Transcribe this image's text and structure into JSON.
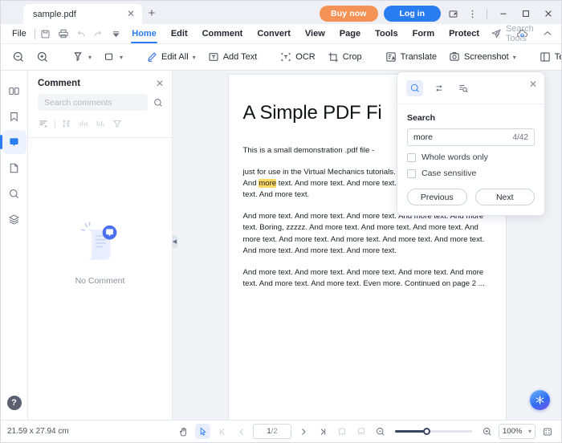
{
  "titlebar": {
    "tab": {
      "label": "sample.pdf",
      "close_icon": "close-icon"
    },
    "new_tab_icon": "plus-icon",
    "buy_now": "Buy now",
    "log_in": "Log in",
    "restore_icon": "restore-window-icon",
    "more_icon": "more-vertical-icon",
    "minimize": "–",
    "maximize": "□",
    "close": "✕"
  },
  "menubar": {
    "file": "File",
    "quick_icons": [
      "save-icon",
      "print-icon",
      "undo-icon",
      "redo-icon",
      "customize-dropdown-icon"
    ],
    "items": [
      {
        "label": "Home",
        "active": true
      },
      {
        "label": "Edit",
        "active": false
      },
      {
        "label": "Comment",
        "active": false
      },
      {
        "label": "Convert",
        "active": false
      },
      {
        "label": "View",
        "active": false
      },
      {
        "label": "Page",
        "active": false
      },
      {
        "label": "Tools",
        "active": false
      },
      {
        "label": "Form",
        "active": false
      },
      {
        "label": "Protect",
        "active": false
      }
    ],
    "search_tools_placeholder": "Search Tools",
    "right_icons": [
      "share-icon",
      "cloud-upload-icon",
      "collapse-ribbon-icon"
    ]
  },
  "ribbon": {
    "items": [
      {
        "name": "zoom-out-button",
        "label": "",
        "icon": "zoom-out-icon",
        "caret": false
      },
      {
        "name": "zoom-in-button",
        "label": "",
        "icon": "zoom-in-icon",
        "caret": false
      },
      {
        "name": "highlight-button",
        "label": "",
        "icon": "highlight-icon",
        "caret": true
      },
      {
        "name": "shape-button",
        "label": "",
        "icon": "rectangle-icon",
        "caret": true
      },
      {
        "name": "edit-all-button",
        "label": "Edit All",
        "icon": "edit-pencil-icon",
        "caret": true
      },
      {
        "name": "add-text-button",
        "label": "Add Text",
        "icon": "add-text-icon",
        "caret": false
      },
      {
        "name": "ocr-button",
        "label": "OCR",
        "icon": "ocr-icon",
        "caret": false
      },
      {
        "name": "crop-button",
        "label": "Crop",
        "icon": "crop-icon",
        "caret": false
      },
      {
        "name": "translate-button",
        "label": "Translate",
        "icon": "translate-icon",
        "caret": false
      },
      {
        "name": "screenshot-button",
        "label": "Screenshot",
        "icon": "camera-icon",
        "caret": true
      },
      {
        "name": "template-button",
        "label": "Temp",
        "icon": "template-icon",
        "caret": false
      }
    ]
  },
  "rail": {
    "items": [
      {
        "name": "sidebar-item-thumbnails",
        "icon": "thumbnails-icon",
        "active": false
      },
      {
        "name": "sidebar-item-bookmarks",
        "icon": "bookmark-icon",
        "active": false
      },
      {
        "name": "sidebar-item-comments",
        "icon": "comment-icon",
        "active": true
      },
      {
        "name": "sidebar-item-attachments",
        "icon": "page-icon",
        "active": false
      },
      {
        "name": "sidebar-item-search",
        "icon": "search-icon",
        "active": false
      },
      {
        "name": "sidebar-item-layers",
        "icon": "layers-icon",
        "active": false
      }
    ],
    "help": "?"
  },
  "comment_panel": {
    "title": "Comment",
    "close_icon": "close-icon",
    "search_placeholder": "Search comments",
    "search_icon": "search-icon",
    "tools": [
      "sort-list-icon",
      "sort-az-icon",
      "filter-bars-icon",
      "group-bars-icon",
      "filter-funnel-icon"
    ],
    "empty_text": "No Comment"
  },
  "document": {
    "heading": "A Simple PDF Fi",
    "paragraphs": [
      "This is a small demonstration .pdf file -",
      "just for use in the Virtual Mechanics tutorials. More text. And more text. And more text. And more text. And more text. And more text. And more text. And more text. And more text.",
      "And more text. And more text. And more text. And more text. And more text. Boring, zzzzz. And more text. And more text. And more text. And more text. And more text. And more text. And more text. And more text. And more text. And more text. And more text.",
      "And more text. And more text. And more text. And more text. And more text. And more text. And more text. Even more. Continued on page 2 ..."
    ],
    "highlight_word": "more",
    "ai_button_icon": "ai-assistant-icon"
  },
  "search_dialog": {
    "tabs": [
      {
        "name": "search-tab",
        "icon": "search-icon",
        "active": true
      },
      {
        "name": "replace-tab",
        "icon": "replace-icon",
        "active": false
      },
      {
        "name": "advanced-search-tab",
        "icon": "search-list-icon",
        "active": false
      }
    ],
    "close_icon": "close-icon",
    "label": "Search",
    "query": "more",
    "match_count": "4/42",
    "whole_words_label": "Whole words only",
    "whole_words_checked": false,
    "case_sensitive_label": "Case sensitive",
    "case_sensitive_checked": false,
    "previous_label": "Previous",
    "next_label": "Next"
  },
  "statusbar": {
    "dimensions": "21.59 x 27.94 cm",
    "hand_tool_icon": "hand-icon",
    "select_tool_icon": "select-cursor-icon",
    "first_page_icon": "first-page-icon",
    "prev_page_icon": "prev-page-icon",
    "current_page": "1",
    "page_separator": "/",
    "total_pages": "2",
    "next_page_icon": "next-page-icon",
    "last_page_icon": "last-page-icon",
    "single_page_icon": "single-page-view-icon",
    "continuous_icon": "continuous-view-icon",
    "zoom_out_icon": "zoom-out-icon",
    "zoom_in_icon": "zoom-in-icon",
    "zoom_level": "100%",
    "zoom_caret": "▾",
    "fit_icon": "fit-page-icon"
  },
  "colors": {
    "accent": "#2a7df0",
    "buy_now": "#f59256",
    "highlight": "#ffd966",
    "app_bg": "#f2f3f7"
  }
}
